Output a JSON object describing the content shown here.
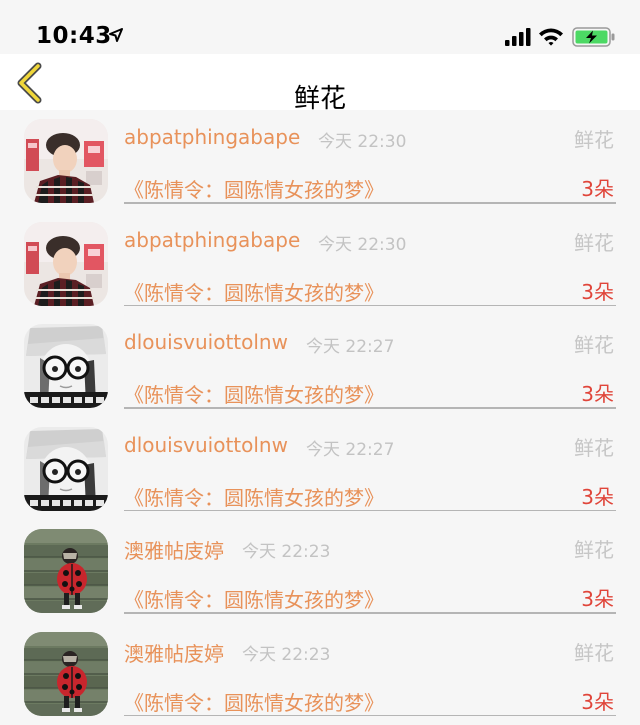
{
  "status_bar": {
    "time": "10:43",
    "icons": [
      "location-arrow-icon",
      "signal-icon",
      "wifi-icon",
      "battery-charging-icon"
    ],
    "battery_color": "#4cd964"
  },
  "nav": {
    "title": "鲜花",
    "back_icon": "chevron-left-icon",
    "back_color": "#f0d73a"
  },
  "colors": {
    "username": "#e8925a",
    "work_title": "#e8925a",
    "quantity": "#e0453a",
    "meta": "#c3c3c3"
  },
  "list": {
    "items": [
      {
        "avatar": "avatar-boy-plaid",
        "username": "abpatphingabape",
        "time": "今天 22:30",
        "gift": "鲜花",
        "title": "《陈情令：圆陈情女孩的梦》",
        "quantity": "3朵"
      },
      {
        "avatar": "avatar-boy-plaid",
        "username": "abpatphingabape",
        "time": "今天 22:30",
        "gift": "鲜花",
        "title": "《陈情令：圆陈情女孩的梦》",
        "quantity": "3朵"
      },
      {
        "avatar": "avatar-glasses-bw",
        "username": "dlouisvuiottolnw",
        "time": "今天 22:27",
        "gift": "鲜花",
        "title": "《陈情令：圆陈情女孩的梦》",
        "quantity": "3朵"
      },
      {
        "avatar": "avatar-glasses-bw",
        "username": "dlouisvuiottolnw",
        "time": "今天 22:27",
        "gift": "鲜花",
        "title": "《陈情令：圆陈情女孩的梦》",
        "quantity": "3朵"
      },
      {
        "avatar": "avatar-ladybug-child",
        "username": "澳雅帖庋婷",
        "time": "今天 22:23",
        "gift": "鲜花",
        "title": "《陈情令：圆陈情女孩的梦》",
        "quantity": "3朵"
      },
      {
        "avatar": "avatar-ladybug-child",
        "username": "澳雅帖庋婷",
        "time": "今天 22:23",
        "gift": "鲜花",
        "title": "《陈情令：圆陈情女孩的梦》",
        "quantity": "3朵"
      }
    ]
  }
}
